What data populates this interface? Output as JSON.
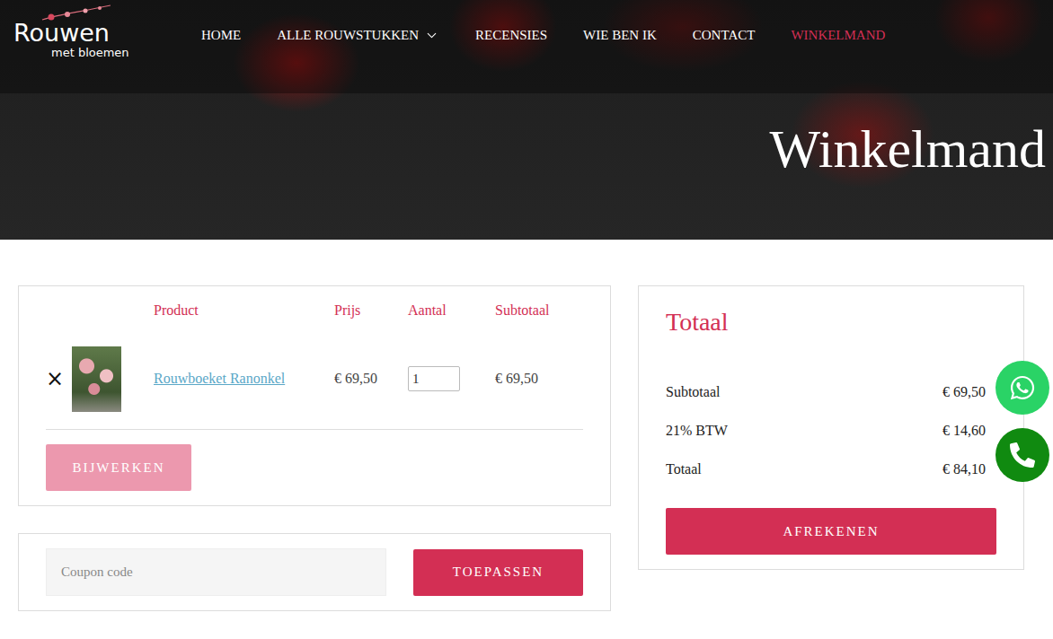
{
  "logo": {
    "title": "Rouwen",
    "subtitle": "met bloemen"
  },
  "nav": [
    {
      "label": "HOME",
      "selected": false,
      "dropdown": false
    },
    {
      "label": "ALLE ROUWSTUKKEN",
      "selected": false,
      "dropdown": true
    },
    {
      "label": "RECENSIES",
      "selected": false,
      "dropdown": false
    },
    {
      "label": "WIE BEN IK",
      "selected": false,
      "dropdown": false
    },
    {
      "label": "CONTACT",
      "selected": false,
      "dropdown": false
    },
    {
      "label": "WINKELMAND",
      "selected": true,
      "dropdown": false
    }
  ],
  "hero": {
    "title": "Winkelmand"
  },
  "cart": {
    "columns": [
      "Product",
      "Prijs",
      "Aantal",
      "Subtotaal"
    ],
    "rows": [
      {
        "remove": "×",
        "product": "Rouwboeket Ranonkel",
        "price": "€ 69,50",
        "quantity": "1",
        "subtotal": "€ 69,50"
      }
    ],
    "update_button": {
      "label": "BIJWERKEN",
      "disabled": true
    }
  },
  "coupon": {
    "placeholder": "Coupon code",
    "button": "TOEPASSEN"
  },
  "totals": {
    "title": "Totaal",
    "rows": [
      {
        "label": "Subtotaal",
        "value": "€ 69,50"
      },
      {
        "label": "21% BTW",
        "value": "€ 14,60"
      },
      {
        "label": "Totaal",
        "value": "€ 84,10"
      }
    ],
    "checkout_button": "AFREKENEN"
  }
}
